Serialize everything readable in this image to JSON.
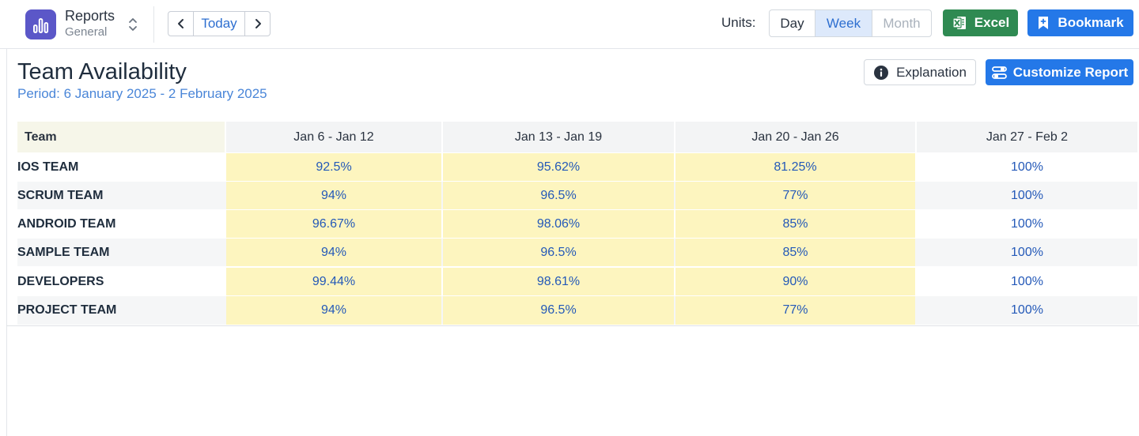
{
  "app": {
    "title": "Reports",
    "subtitle": "General"
  },
  "nav": {
    "today_label": "Today"
  },
  "units": {
    "label": "Units:",
    "options": [
      "Day",
      "Week",
      "Month"
    ],
    "selected": "Week"
  },
  "toolbar": {
    "excel_label": "Excel",
    "bookmark_label": "Bookmark"
  },
  "page": {
    "title": "Team Availability",
    "period": "Period: 6 January 2025 - 2 February 2025",
    "explanation_label": "Explanation",
    "customize_label": "Customize Report"
  },
  "table": {
    "headers": [
      "Team",
      "Jan 6 - Jan 12",
      "Jan 13 - Jan 19",
      "Jan 20 - Jan 26",
      "Jan 27 - Feb 2"
    ],
    "rows": [
      {
        "team": "IOS TEAM",
        "values": [
          "92.5%",
          "95.62%",
          "81.25%",
          "100%"
        ]
      },
      {
        "team": "SCRUM TEAM",
        "values": [
          "94%",
          "96.5%",
          "77%",
          "100%"
        ]
      },
      {
        "team": "ANDROID TEAM",
        "values": [
          "96.67%",
          "98.06%",
          "85%",
          "100%"
        ]
      },
      {
        "team": "SAMPLE TEAM",
        "values": [
          "94%",
          "96.5%",
          "85%",
          "100%"
        ]
      },
      {
        "team": "DEVELOPERS",
        "values": [
          "99.44%",
          "98.61%",
          "90%",
          "100%"
        ]
      },
      {
        "team": "PROJECT TEAM",
        "values": [
          "94%",
          "96.5%",
          "77%",
          "100%"
        ]
      }
    ]
  },
  "colors": {
    "accent": "#2478e8",
    "excel": "#2f8a52",
    "highlight": "#fdf5bf",
    "app_icon": "#5b57c8"
  }
}
